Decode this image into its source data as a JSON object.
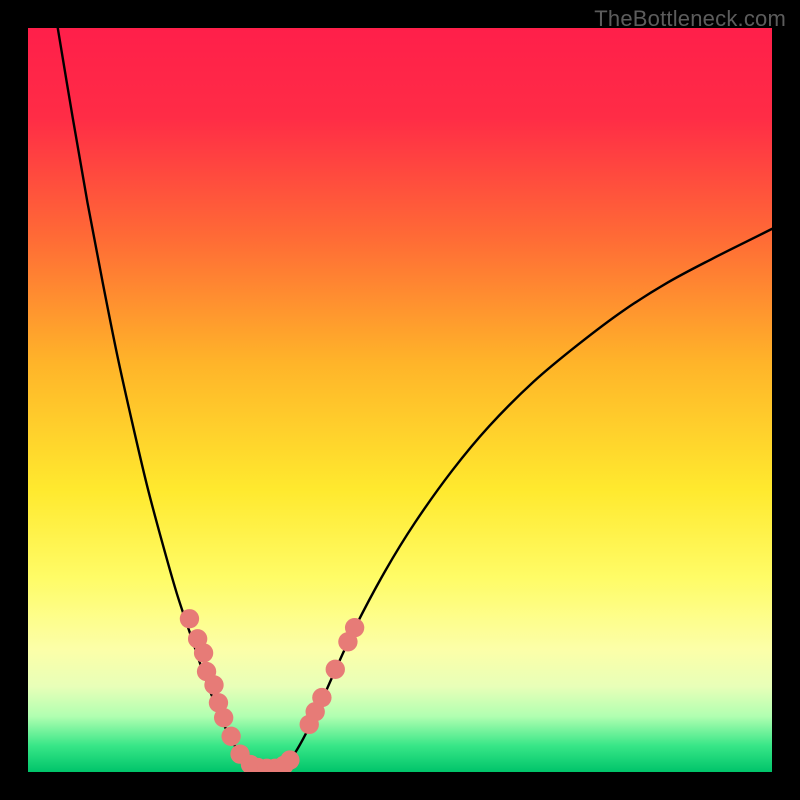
{
  "watermark": "TheBottleneck.com",
  "chart_data": {
    "type": "line",
    "title": "",
    "xlabel": "",
    "ylabel": "",
    "xlim": [
      0,
      100
    ],
    "ylim": [
      0,
      100
    ],
    "background_gradient": {
      "stops": [
        {
          "offset": 0.0,
          "color": "#ff1f4a"
        },
        {
          "offset": 0.12,
          "color": "#ff2c46"
        },
        {
          "offset": 0.28,
          "color": "#ff6a36"
        },
        {
          "offset": 0.45,
          "color": "#ffb429"
        },
        {
          "offset": 0.62,
          "color": "#ffe92e"
        },
        {
          "offset": 0.74,
          "color": "#fffc67"
        },
        {
          "offset": 0.835,
          "color": "#fcffa8"
        },
        {
          "offset": 0.885,
          "color": "#e8ffb8"
        },
        {
          "offset": 0.925,
          "color": "#b1ffb1"
        },
        {
          "offset": 0.965,
          "color": "#37e687"
        },
        {
          "offset": 1.0,
          "color": "#00c46a"
        }
      ]
    },
    "series": [
      {
        "name": "left-curve",
        "stroke": "#000000",
        "points": [
          {
            "x": 4.0,
            "y": 100.0
          },
          {
            "x": 6.0,
            "y": 88.0
          },
          {
            "x": 8.0,
            "y": 76.5
          },
          {
            "x": 10.0,
            "y": 66.0
          },
          {
            "x": 12.0,
            "y": 56.0
          },
          {
            "x": 14.0,
            "y": 47.0
          },
          {
            "x": 16.0,
            "y": 38.5
          },
          {
            "x": 18.0,
            "y": 31.0
          },
          {
            "x": 20.0,
            "y": 24.0
          },
          {
            "x": 22.0,
            "y": 18.0
          },
          {
            "x": 23.5,
            "y": 13.5
          },
          {
            "x": 25.0,
            "y": 9.5
          },
          {
            "x": 26.5,
            "y": 6.0
          },
          {
            "x": 28.0,
            "y": 3.2
          },
          {
            "x": 29.5,
            "y": 1.4
          },
          {
            "x": 31.0,
            "y": 0.4
          }
        ]
      },
      {
        "name": "right-curve",
        "stroke": "#000000",
        "points": [
          {
            "x": 34.0,
            "y": 0.4
          },
          {
            "x": 35.5,
            "y": 2.0
          },
          {
            "x": 37.0,
            "y": 4.5
          },
          {
            "x": 39.0,
            "y": 8.5
          },
          {
            "x": 41.0,
            "y": 13.0
          },
          {
            "x": 44.0,
            "y": 19.5
          },
          {
            "x": 48.0,
            "y": 27.0
          },
          {
            "x": 52.0,
            "y": 33.5
          },
          {
            "x": 57.0,
            "y": 40.5
          },
          {
            "x": 62.0,
            "y": 46.5
          },
          {
            "x": 68.0,
            "y": 52.5
          },
          {
            "x": 74.0,
            "y": 57.5
          },
          {
            "x": 80.0,
            "y": 62.0
          },
          {
            "x": 86.0,
            "y": 65.8
          },
          {
            "x": 92.0,
            "y": 69.0
          },
          {
            "x": 98.0,
            "y": 72.0
          },
          {
            "x": 100.0,
            "y": 73.0
          }
        ]
      }
    ],
    "markers": {
      "color": "#e77b77",
      "radius": 1.3,
      "points": [
        {
          "x": 21.7,
          "y": 20.6
        },
        {
          "x": 22.8,
          "y": 17.9
        },
        {
          "x": 23.6,
          "y": 16.0
        },
        {
          "x": 24.0,
          "y": 13.5
        },
        {
          "x": 25.0,
          "y": 11.7
        },
        {
          "x": 25.6,
          "y": 9.3
        },
        {
          "x": 26.3,
          "y": 7.3
        },
        {
          "x": 27.3,
          "y": 4.8
        },
        {
          "x": 28.5,
          "y": 2.4
        },
        {
          "x": 29.9,
          "y": 1.0
        },
        {
          "x": 30.9,
          "y": 0.6
        },
        {
          "x": 32.1,
          "y": 0.5
        },
        {
          "x": 33.2,
          "y": 0.5
        },
        {
          "x": 34.4,
          "y": 0.9
        },
        {
          "x": 35.2,
          "y": 1.6
        },
        {
          "x": 37.8,
          "y": 6.4
        },
        {
          "x": 38.6,
          "y": 8.1
        },
        {
          "x": 39.5,
          "y": 10.0
        },
        {
          "x": 41.3,
          "y": 13.8
        },
        {
          "x": 43.0,
          "y": 17.5
        },
        {
          "x": 43.9,
          "y": 19.4
        }
      ]
    }
  }
}
